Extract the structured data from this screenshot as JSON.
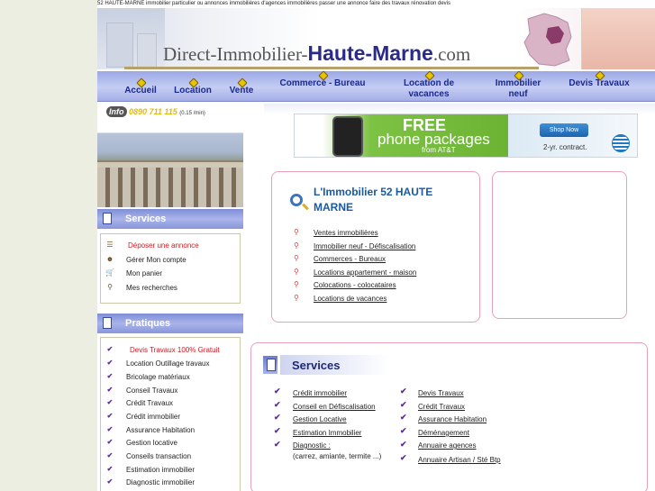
{
  "top_text": "52 HAUTE-MARNE immobilier particulier ou annonces immobilières d'agences immobilières passer une annonce faire des travaux rénovation devis",
  "site_name": {
    "prefix": "Direct-Immobilier-",
    "highlight": "Haute-Marne",
    "suffix": ".com"
  },
  "nav": [
    {
      "label": "Accueil"
    },
    {
      "label": "Location"
    },
    {
      "label": "Vente"
    },
    {
      "label": "Commerce - Bureau"
    },
    {
      "label": "Location de vacances"
    },
    {
      "label": "Immobilier neuf"
    },
    {
      "label": "Devis Travaux"
    }
  ],
  "info": {
    "badge": "Info",
    "phone": "0890 711 115",
    "price": "(0.15 /min)"
  },
  "ad": {
    "headline": "FREE",
    "subline": "phone packages",
    "from": "from AT&T",
    "button": "Shop Now",
    "contract": "2-yr. contract."
  },
  "sidebar": {
    "services": {
      "title": "Services",
      "items": [
        {
          "label": "Déposer une annonce",
          "icon": "post-ad-icon",
          "highlight": true
        },
        {
          "label": "Gérer Mon compte",
          "icon": "account-icon"
        },
        {
          "label": "Mon panier",
          "icon": "cart-icon"
        },
        {
          "label": "Mes recherches",
          "icon": "search-icon"
        }
      ]
    },
    "pratiques": {
      "title": "Pratiques",
      "items": [
        {
          "label": "Devis Travaux 100% Gratuit",
          "highlight": true
        },
        {
          "label": "Location Outillage travaux"
        },
        {
          "label": "Bricolage matériaux"
        },
        {
          "label": "Conseil Travaux"
        },
        {
          "label": "Crédit Travaux"
        },
        {
          "label": "Crédit immobilier"
        },
        {
          "label": "Assurance Habitation"
        },
        {
          "label": "Gestion locative"
        },
        {
          "label": "Conseils transaction"
        },
        {
          "label": "Estimation immobilier"
        },
        {
          "label": "Diagnostic immobilier"
        }
      ]
    }
  },
  "main": {
    "title": "L'Immobilier 52 HAUTE MARNE",
    "links": [
      "Ventes immobilières",
      "Immobilier neuf - Défiscalisation",
      "Commerces - Bureaux",
      "Locations appartement - maison",
      "Colocations - colocataires",
      "Locations de vacances"
    ]
  },
  "services": {
    "title": "Services",
    "col1": [
      {
        "label": "Crédit immobilier"
      },
      {
        "label": "Conseil en Défiscalisation"
      },
      {
        "label": "Gestion Locative"
      },
      {
        "label": "Estimation Immobilier"
      },
      {
        "label": "Diagnostic :",
        "sub": "(carrez, amiante, termite ...)"
      }
    ],
    "col2": [
      {
        "label": "Devis Travaux"
      },
      {
        "label": "Crédit Travaux"
      },
      {
        "label": "Assurance Habitation"
      },
      {
        "label": "Déménagement"
      },
      {
        "label": "Annuaire agences"
      },
      {
        "label": "Annuaire Artisan / Sté Btp"
      }
    ]
  },
  "colors": {
    "nav_text": "#1c2a8c",
    "highlight_red": "#d0181f",
    "title_blue": "#1a5aa3",
    "box_border": "#e9a2b5"
  }
}
